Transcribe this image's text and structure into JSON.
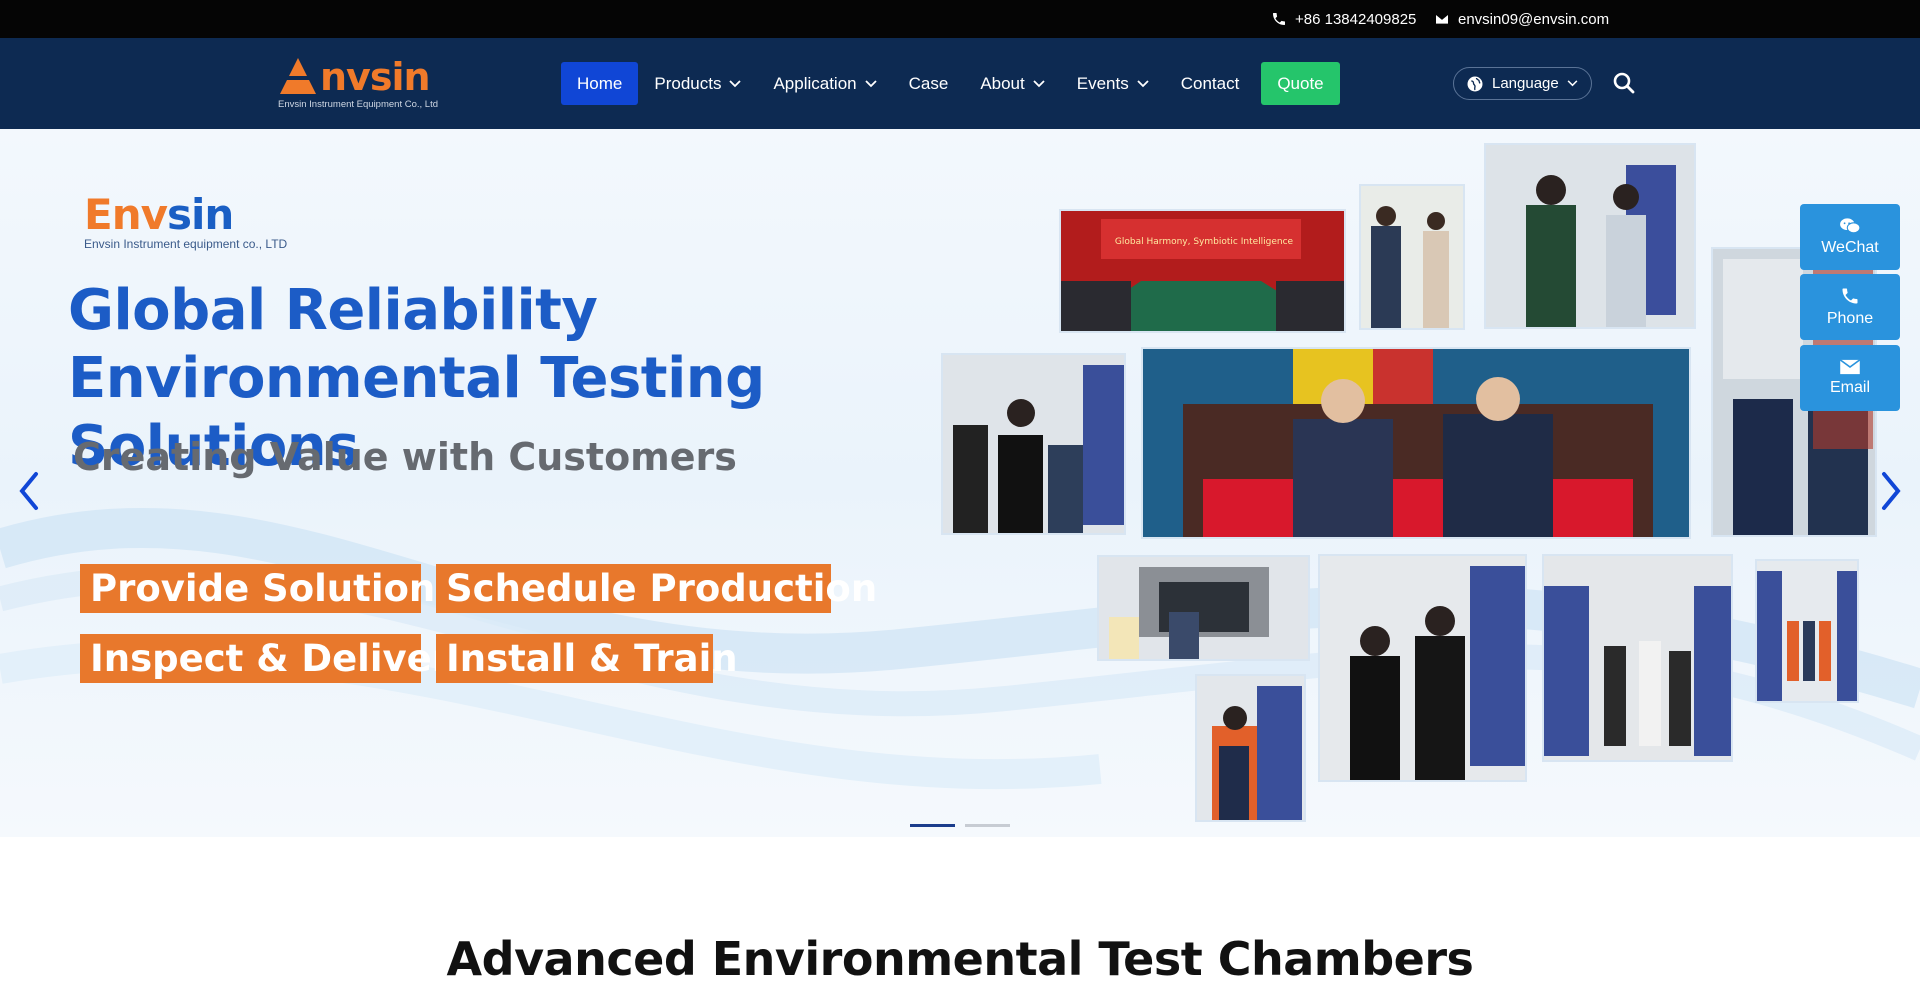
{
  "topbar": {
    "phone": "+86 13842409825",
    "email": "envsin09@envsin.com"
  },
  "nav": {
    "logo": {
      "word_a": "E",
      "word_b": "nvsin",
      "tagline": "Envsin Instrument Equipment Co., Ltd"
    },
    "items": [
      {
        "label": "Home",
        "dropdown": false,
        "active": true
      },
      {
        "label": "Products",
        "dropdown": true
      },
      {
        "label": "Application",
        "dropdown": true
      },
      {
        "label": "Case",
        "dropdown": false
      },
      {
        "label": "About",
        "dropdown": true
      },
      {
        "label": "Events",
        "dropdown": true
      },
      {
        "label": "Contact",
        "dropdown": false
      },
      {
        "label": "Quote",
        "dropdown": false
      }
    ],
    "language": "Language",
    "icons": [
      "phone-icon",
      "mail-icon",
      "globe-icon",
      "search-icon",
      "chevron-down-icon"
    ]
  },
  "hero": {
    "logo": {
      "word_a": "Env",
      "word_b": "sin",
      "tagline": "Envsin Instrument equipment co., LTD"
    },
    "headline": "Global Reliability Environmental Testing Solutions",
    "subhead": "Creating Value with Customers",
    "pills": [
      "Provide Solutions",
      "Schedule Production",
      "Inspect & Deliver",
      "Install & Train"
    ],
    "banner_text": "Global Harmony, Symbiotic Intelligence",
    "slides": 2,
    "active_slide": 1
  },
  "side_widgets": [
    "WeChat",
    "Phone",
    "Email"
  ],
  "section": {
    "title": "Advanced Environmental Test Chambers"
  },
  "colors": {
    "topbar": "#050505",
    "nav": "#0d2a52",
    "active": "#1046d6",
    "quote": "#25c56b",
    "accent": "#e8782c",
    "headline": "#1c5cc6",
    "widget": "#2a93dd"
  }
}
